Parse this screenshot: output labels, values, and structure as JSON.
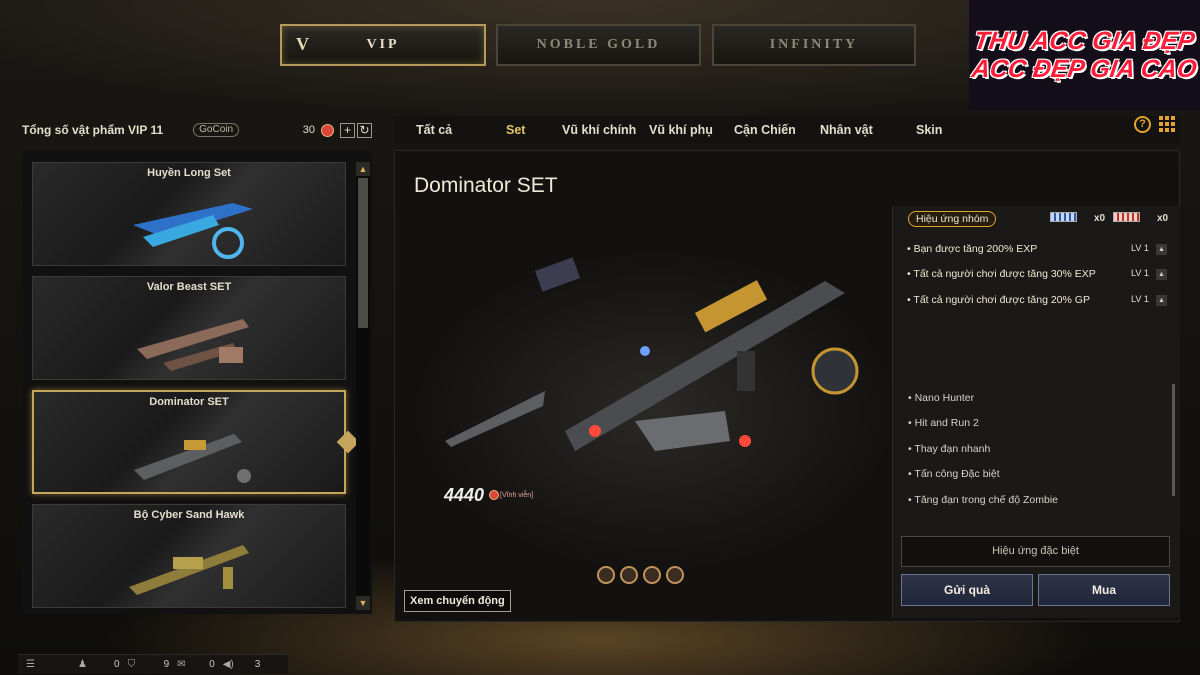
{
  "top_tabs": [
    {
      "label": "VIP",
      "mark": "V"
    },
    {
      "label": "NOBLE GOLD"
    },
    {
      "label": "INFINITY"
    }
  ],
  "promo": {
    "line1": "THU ACC GIA ĐẸP",
    "line2": "ACC ĐẸP GIA CAO"
  },
  "left": {
    "title": "Tổng số vật phẩm VIP 11",
    "gocoin": "GoCoin",
    "count": "30",
    "plus": "+",
    "refresh": "↻",
    "items": [
      {
        "name": "Huyền Long Set"
      },
      {
        "name": "Valor Beast SET"
      },
      {
        "name": "Dominator SET"
      },
      {
        "name": "Bộ Cyber Sand Hawk"
      }
    ]
  },
  "categories": [
    {
      "label": "Tất cả"
    },
    {
      "label": "Set"
    },
    {
      "label": "Vũ khí chính"
    },
    {
      "label": "Vũ khí phụ"
    },
    {
      "label": "Cận Chiến"
    },
    {
      "label": "Nhân vật"
    },
    {
      "label": "Skin"
    }
  ],
  "main": {
    "set_name": "Dominator SET",
    "price": "4440",
    "price_tag": "[Vĩnh viễn]",
    "view_motion": "Xem chuyển động"
  },
  "info": {
    "group_badge": "Hiệu ứng nhóm",
    "flag_a_count": "x0",
    "flag_b_count": "x0",
    "buffs": [
      {
        "text": "• Bạn được tăng 200%  EXP",
        "lv": "LV 1"
      },
      {
        "text": "• Tất cả người chơi được tăng 30% EXP",
        "lv": "LV 1"
      },
      {
        "text": "• Tất cả người chơi được tăng 20% GP",
        "lv": "LV 1"
      }
    ],
    "features": [
      "• Nano Hunter",
      "• Hit and Run 2",
      "• Thay đạn nhanh",
      "• Tấn công Đặc biệt",
      "• Tăng đạn trong chế độ Zombie"
    ],
    "special": "Hiệu ứng đặc biệt",
    "gift": "Gửi quà",
    "buy": "Mua"
  },
  "status": {
    "v1": "0",
    "v2": "9",
    "v3": "0",
    "v4": "3"
  }
}
